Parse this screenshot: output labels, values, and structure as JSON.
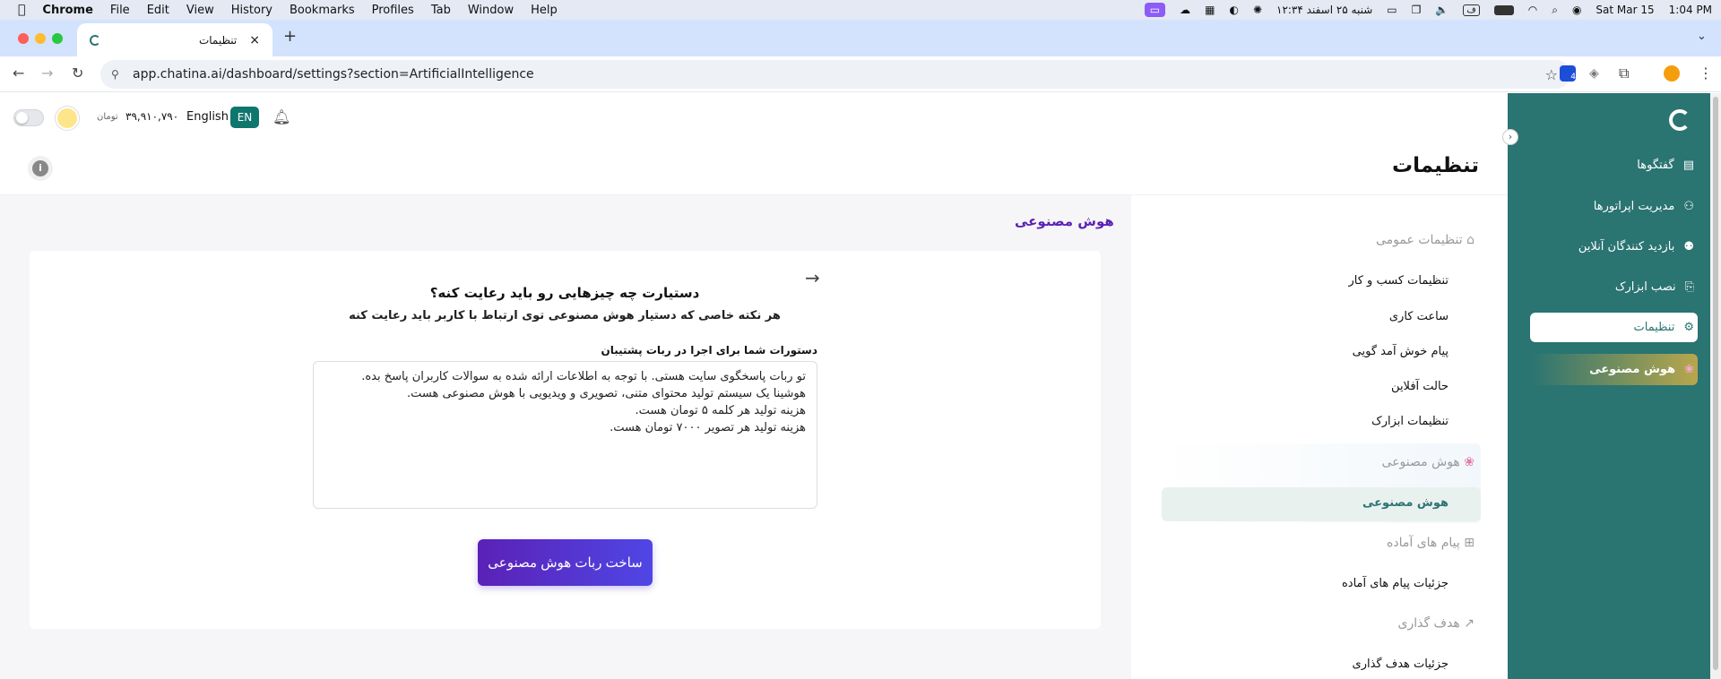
{
  "macos": {
    "menu": [
      "Chrome",
      "File",
      "Edit",
      "View",
      "History",
      "Bookmarks",
      "Profiles",
      "Tab",
      "Window",
      "Help"
    ],
    "persian_date": "شنبه ۲۵ اسفند ۱۲:۳۴",
    "date": "Sat Mar 15",
    "time": "1:04 PM"
  },
  "browser": {
    "tab_title": "تنظیمات",
    "url": "app.chatina.ai/dashboard/settings?section=ArtificialIntelligence",
    "new_tab": "+",
    "ext_badge": "4"
  },
  "topbar": {
    "balance": "۳۹,۹۱۰,۷۹۰",
    "currency": "تومان",
    "language": "English",
    "lang_code": "EN"
  },
  "page": {
    "title": "تنظیمات",
    "section_title": "هوش مصنوعی"
  },
  "card": {
    "heading": "دستیارت چه چیزهایی رو باید رعایت کنه؟",
    "subheading": "هر نکته خاصی که دستیار هوش مصنوعی توی ارتباط با کاربر باید رعایت کنه",
    "field_label": "دستورات شما برای اجرا در ربات پشتیبان",
    "field_value": "تو ربات پاسخگوی سایت هستی. با توجه به اطلاعات ارائه شده به سوالات کاربران پاسخ بده.\nهوشینا یک سیستم تولید محتوای متنی، تصویری و ویدیویی با هوش مصنوعی هست.\nهزینه تولید هر کلمه ۵ تومان هست.\nهزینه تولید هر تصویر ۷۰۰۰ تومان هست.",
    "button": "ساخت ربات هوش مصنوعی"
  },
  "settings_menu": {
    "general_group": "تنظیمات عمومی",
    "general_items": [
      "تنظیمات کسب و کار",
      "ساعت کاری",
      "پیام خوش آمد گویی",
      "حالت آفلاین",
      "تنظیمات ابزارک"
    ],
    "ai_group": "هوش مصنوعی",
    "ai_items": [
      "هوش مصنوعی"
    ],
    "canned_group": "پیام های آماده",
    "canned_items": [
      "جزئیات پیام های آماده"
    ],
    "goal_group": "هدف گذاری",
    "goal_items": [
      "جزئیات هدف گذاری"
    ]
  },
  "sidebar": {
    "items": [
      {
        "label": "گفتگوها",
        "icon": "chat-icon"
      },
      {
        "label": "مدیریت اپراتورها",
        "icon": "add-user-icon"
      },
      {
        "label": "بازدید کنندگان آنلاین",
        "icon": "users-icon"
      },
      {
        "label": "نصب ابزارک",
        "icon": "install-icon"
      },
      {
        "label": "تنظیمات",
        "icon": "gear-icon"
      },
      {
        "label": "هوش مصنوعی",
        "icon": "brain-icon"
      }
    ]
  },
  "colors": {
    "sidebar": "#2a7472",
    "accent": "#4f46e5",
    "section_title": "#5b21b6",
    "lang_badge": "#0f766e"
  }
}
